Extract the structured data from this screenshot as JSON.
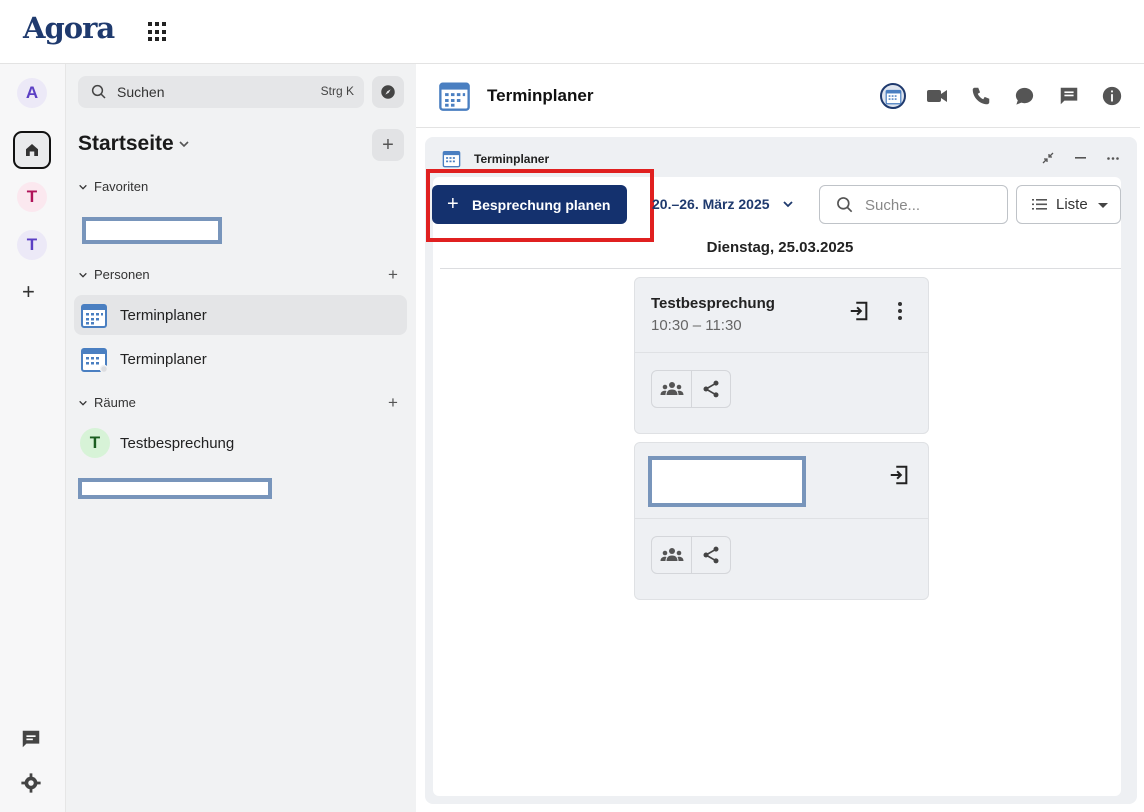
{
  "app": {
    "logo": "Agora"
  },
  "rail": {
    "avatar_letter": "A",
    "space_letters": [
      "T",
      "T"
    ],
    "add_glyph": "+"
  },
  "sidebar": {
    "search_placeholder": "Suchen",
    "search_shortcut": "Strg K",
    "home_title": "Startseite",
    "add_glyph": "+",
    "sections": {
      "favorites": "Favoriten",
      "people": "Personen",
      "rooms": "Räume"
    },
    "people_items": [
      {
        "label": "Terminplaner"
      },
      {
        "label": "Terminplaner"
      }
    ],
    "room_items": [
      {
        "label": "Testbesprechung",
        "letter": "T"
      }
    ]
  },
  "main": {
    "title": "Terminplaner",
    "widget": {
      "title": "Terminplaner",
      "primary_button": "Besprechung planen",
      "primary_glyph": "+",
      "date_range": "20.–26. März 2025",
      "search_placeholder": "Suche...",
      "view_label": "Liste",
      "day_label": "Dienstag, 25.03.2025",
      "meetings": [
        {
          "title": "Testbesprechung",
          "time": "10:30 – 11:30"
        }
      ]
    }
  },
  "colors": {
    "primary": "#14316e",
    "highlight": "#e02020",
    "redaction": "#7895bb"
  }
}
